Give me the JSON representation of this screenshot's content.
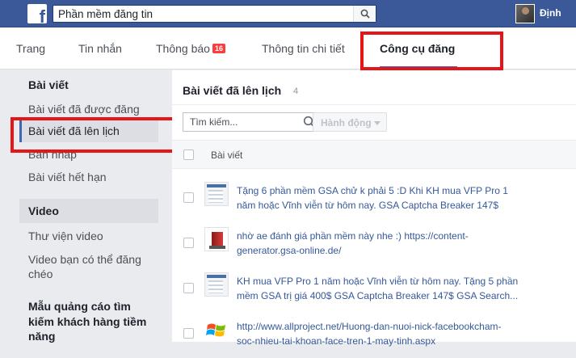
{
  "topbar": {
    "logo_letter": "f",
    "search_value": "Phần mềm đăng tin",
    "user_name": "Định"
  },
  "tabs": [
    {
      "label": "Trang"
    },
    {
      "label": "Tin nhắn"
    },
    {
      "label": "Thông báo",
      "badge": "16"
    },
    {
      "label": "Thông tin chi tiết"
    },
    {
      "label": "Công cụ đăng"
    }
  ],
  "sidebar": {
    "section_posts": "Bài viết",
    "items_posts": [
      "Bài viết đã được đăng",
      "Bài viết đã lên lịch",
      "Bản nháp",
      "Bài viết hết hạn"
    ],
    "section_video": "Video",
    "items_video": [
      "Thư viện video",
      "Video bạn có thể đăng chéo"
    ],
    "section_ads_line1": "Mẫu quảng cáo tìm",
    "section_ads_line2": "kiếm khách hàng tiềm",
    "section_ads_line3": "năng"
  },
  "main": {
    "title": "Bài viết đã lên lịch",
    "count": "4",
    "filter_placeholder": "Tìm kiếm...",
    "action_label": "Hành động",
    "column_label": "Bài viết",
    "rows": [
      {
        "line1": "Tặng 6 phần mềm GSA chử k phải 5 :D Khi KH mua VFP Pro 1",
        "line2": "năm hoặc Vĩnh viễn từ hôm nay. GSA Captcha Breaker 147$"
      },
      {
        "line1": "nhờ ae đánh giá phần mềm này nhe :) https://content-",
        "line2": "generator.gsa-online.de/"
      },
      {
        "line1": "KH mua VFP Pro 1 năm hoặc Vĩnh viễn từ hôm nay. Tặng 5 phần",
        "line2": "mềm GSA trị giá 400$ GSA Captcha Breaker 147$ GSA Search..."
      },
      {
        "line1": "http://www.allproject.net/Huong-dan-nuoi-nick-facebookcham-",
        "line2": "soc-nhieu-tai-khoan-face-tren-1-may-tinh.aspx"
      }
    ]
  },
  "colors": {
    "fb_blue": "#3b5998",
    "link": "#365899",
    "highlight": "#e5161a",
    "badge": "#fa3e3e"
  }
}
